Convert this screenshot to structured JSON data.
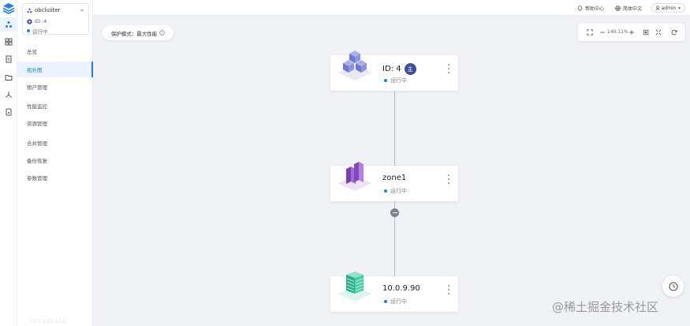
{
  "cluster": {
    "name": "obcluster",
    "id_text": "ID: 4",
    "status": "运行中"
  },
  "nav": [
    {
      "label": "总览"
    },
    {
      "label": "拓扑图",
      "active": true
    },
    {
      "label": "租户管理"
    },
    {
      "label": "性能监控"
    },
    {
      "label": "资源管理"
    },
    {
      "label": "合并管理"
    },
    {
      "label": "备份恢复"
    },
    {
      "label": "参数管理"
    }
  ],
  "sidebar_footer": "OCEANBASE",
  "topbar": {
    "help": "帮助中心",
    "language": "简体中文",
    "user": "admin"
  },
  "canvas": {
    "protect_mode": "保护模式：最大性能",
    "zoom_level": "140.11%"
  },
  "nodes": [
    {
      "type": "cluster",
      "title": "ID: 4",
      "badge": "主",
      "status": "运行中"
    },
    {
      "type": "zone",
      "title": "zone1",
      "status": "运行中"
    },
    {
      "type": "server",
      "title": "10.0.9.90",
      "status": "运行中"
    }
  ],
  "watermark": "@稀土掘金技术社区",
  "colors": {
    "primary": "#1f7ee8",
    "badge": "#3f4fa0",
    "cluster_icon": "#7f88d6",
    "zone_icon": "#9b5cc9",
    "server_icon": "#3ec5a4"
  }
}
